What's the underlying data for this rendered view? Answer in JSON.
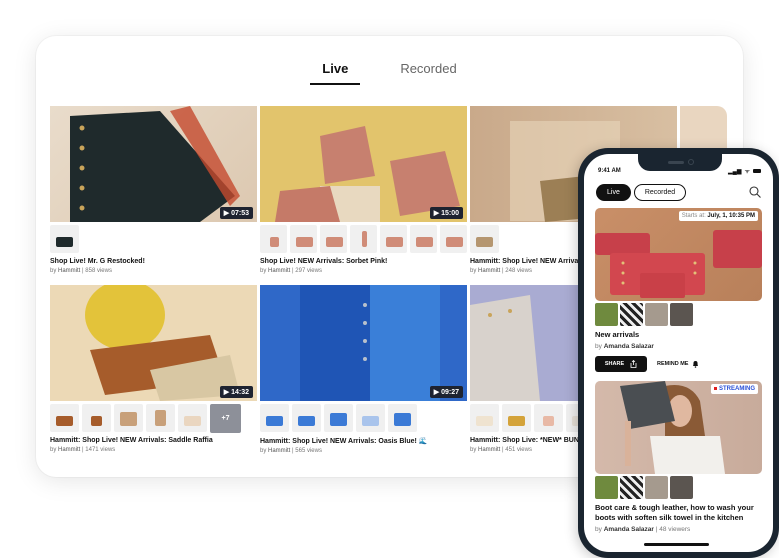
{
  "desktop": {
    "tabs": [
      {
        "label": "Live",
        "active": true
      },
      {
        "label": "Recorded",
        "active": false
      }
    ],
    "videos": [
      {
        "title": "Shop Live! Mr. G Restocked!",
        "by": "by",
        "author": "Hammitt",
        "views": "858 views",
        "duration": "07:53",
        "product_count": 1
      },
      {
        "title": "Shop Live! NEW Arrivals: Sorbet Pink!",
        "by": "by",
        "author": "Hammitt",
        "views": "297 views",
        "duration": "15:00",
        "product_count": 7
      },
      {
        "title": "Hammitt: Shop Live! NEW Arrivals: S",
        "by": "by",
        "author": "Hammitt",
        "views": "248 views",
        "duration": "",
        "product_count": 1
      },
      {
        "title": "Hammitt: Shop Live! NEW Arrivals: Saddle Raffia",
        "by": "by",
        "author": "Hammitt",
        "views": "1471 views",
        "duration": "14:32",
        "product_count": 5,
        "more": "+7"
      },
      {
        "title": "Hammitt: Shop Live! NEW Arrivals: Oasis Blue! 🌊",
        "by": "by",
        "author": "Hammitt",
        "views": "565 views",
        "duration": "09:27",
        "product_count": 5
      },
      {
        "title": "Hammitt: Shop Live: *NEW* BUNDLE",
        "by": "by",
        "author": "Hammitt",
        "views": "451 views",
        "duration": "",
        "product_count": 4
      }
    ],
    "separator": "|"
  },
  "phone": {
    "time": "9:41 AM",
    "tabs": [
      {
        "label": "Live",
        "active": true
      },
      {
        "label": "Recorded",
        "active": false
      }
    ],
    "search_icon": "search-icon",
    "feed": [
      {
        "badge_prefix": "Starts at:",
        "badge_value": "July, 1, 10:35 PM",
        "title": "New arrivals",
        "by": "by",
        "author": "Amanda Salazar",
        "share_label": "SHARE",
        "remind_label": "REMIND ME"
      },
      {
        "badge_label": "STREAMING",
        "title": "Boot care & tough leather, how to wash your boots with soften silk towel in the kitchen",
        "by": "by",
        "author": "Amanda Salazar",
        "viewers": "48 viewers"
      }
    ]
  },
  "colors": {
    "accent_dark": "#111111",
    "streaming_blue": "#2a4fd6",
    "live_dot": "#e02020",
    "duration_bg": "#1e2330"
  }
}
